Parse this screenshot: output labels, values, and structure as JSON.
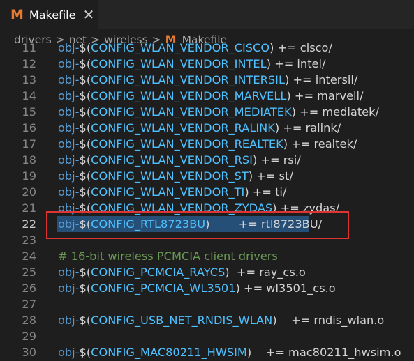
{
  "tab": {
    "title": "Makefile",
    "icon": "M",
    "close": "✕"
  },
  "breadcrumb": [
    "drivers",
    "net",
    "wireless",
    "Makefile"
  ],
  "breadcrumb_sep": ">",
  "breadcrumb_icon": "M",
  "lines": [
    {
      "n": "11",
      "obj": "obj-",
      "dollar": "$(",
      "var": "CONFIG_WLAN_VENDOR_CISCO",
      "close": ")",
      "rest": " += cisco/"
    },
    {
      "n": "12",
      "obj": "obj-",
      "dollar": "$(",
      "var": "CONFIG_WLAN_VENDOR_INTEL",
      "close": ")",
      "rest": " += intel/"
    },
    {
      "n": "13",
      "obj": "obj-",
      "dollar": "$(",
      "var": "CONFIG_WLAN_VENDOR_INTERSIL",
      "close": ")",
      "rest": " += intersil/"
    },
    {
      "n": "14",
      "obj": "obj-",
      "dollar": "$(",
      "var": "CONFIG_WLAN_VENDOR_MARVELL",
      "close": ")",
      "rest": " += marvell/"
    },
    {
      "n": "15",
      "obj": "obj-",
      "dollar": "$(",
      "var": "CONFIG_WLAN_VENDOR_MEDIATEK",
      "close": ")",
      "rest": " += mediatek/"
    },
    {
      "n": "16",
      "obj": "obj-",
      "dollar": "$(",
      "var": "CONFIG_WLAN_VENDOR_RALINK",
      "close": ")",
      "rest": " += ralink/"
    },
    {
      "n": "17",
      "obj": "obj-",
      "dollar": "$(",
      "var": "CONFIG_WLAN_VENDOR_REALTEK",
      "close": ")",
      "rest": " += realtek/"
    },
    {
      "n": "18",
      "obj": "obj-",
      "dollar": "$(",
      "var": "CONFIG_WLAN_VENDOR_RSI",
      "close": ")",
      "rest": " += rsi/"
    },
    {
      "n": "19",
      "obj": "obj-",
      "dollar": "$(",
      "var": "CONFIG_WLAN_VENDOR_ST",
      "close": ")",
      "rest": " += st/"
    },
    {
      "n": "20",
      "obj": "obj-",
      "dollar": "$(",
      "var": "CONFIG_WLAN_VENDOR_TI",
      "close": ")",
      "rest": " += ti/"
    },
    {
      "n": "21",
      "obj": "obj-",
      "dollar": "$(",
      "var": "CONFIG_WLAN_VENDOR_ZYDAS",
      "close": ")",
      "rest": " += zydas/"
    },
    {
      "n": "22",
      "obj": "obj-",
      "dollar": "$(",
      "var": "CONFIG_RTL8723BU",
      "close": ")",
      "rest": "        += rtl8723BU/",
      "active": true
    },
    {
      "n": "23"
    },
    {
      "n": "24",
      "comment": "# 16-bit wireless PCMCIA client drivers"
    },
    {
      "n": "25",
      "obj": "obj-",
      "dollar": "$(",
      "var": "CONFIG_PCMCIA_RAYCS",
      "close": ")",
      "rest": "  += ray_cs.o"
    },
    {
      "n": "26",
      "obj": "obj-",
      "dollar": "$(",
      "var": "CONFIG_PCMCIA_WL3501",
      "close": ")",
      "rest": " += wl3501_cs.o"
    },
    {
      "n": "27"
    },
    {
      "n": "28",
      "obj": "obj-",
      "dollar": "$(",
      "var": "CONFIG_USB_NET_RNDIS_WLAN",
      "close": ")",
      "rest": "    += rndis_wlan.o"
    },
    {
      "n": "29"
    },
    {
      "n": "30",
      "obj": "obj-",
      "dollar": "$(",
      "var": "CONFIG_MAC80211_HWSIM",
      "close": ")",
      "rest": "    += mac80211_hwsim.o"
    }
  ],
  "colors": {
    "background": "#1e1e1e",
    "selection": "#264f78",
    "highlight_box": "#e03434",
    "make_icon": "#e37933"
  }
}
